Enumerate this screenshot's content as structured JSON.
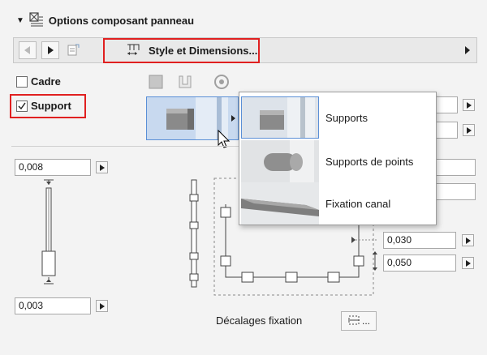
{
  "header": {
    "title": "Options composant panneau"
  },
  "toolbar": {
    "style_label": "Style et Dimensions..."
  },
  "checkboxes": {
    "cadre": {
      "label": "Cadre",
      "checked": false
    },
    "support": {
      "label": "Support",
      "checked": true
    }
  },
  "fields": {
    "top_left": "0,008",
    "bottom_left": "0,003",
    "right_1": "0,030",
    "right_2": "0,050"
  },
  "dropdown": {
    "items": [
      {
        "label": "Supports"
      },
      {
        "label": "Supports de points"
      },
      {
        "label": "Fixation canal"
      }
    ]
  },
  "footer": {
    "decalages_label": "Décalages fixation",
    "decalages_button": "..."
  },
  "colors": {
    "highlight": "#e02020",
    "selection": "#5a8fd6"
  }
}
